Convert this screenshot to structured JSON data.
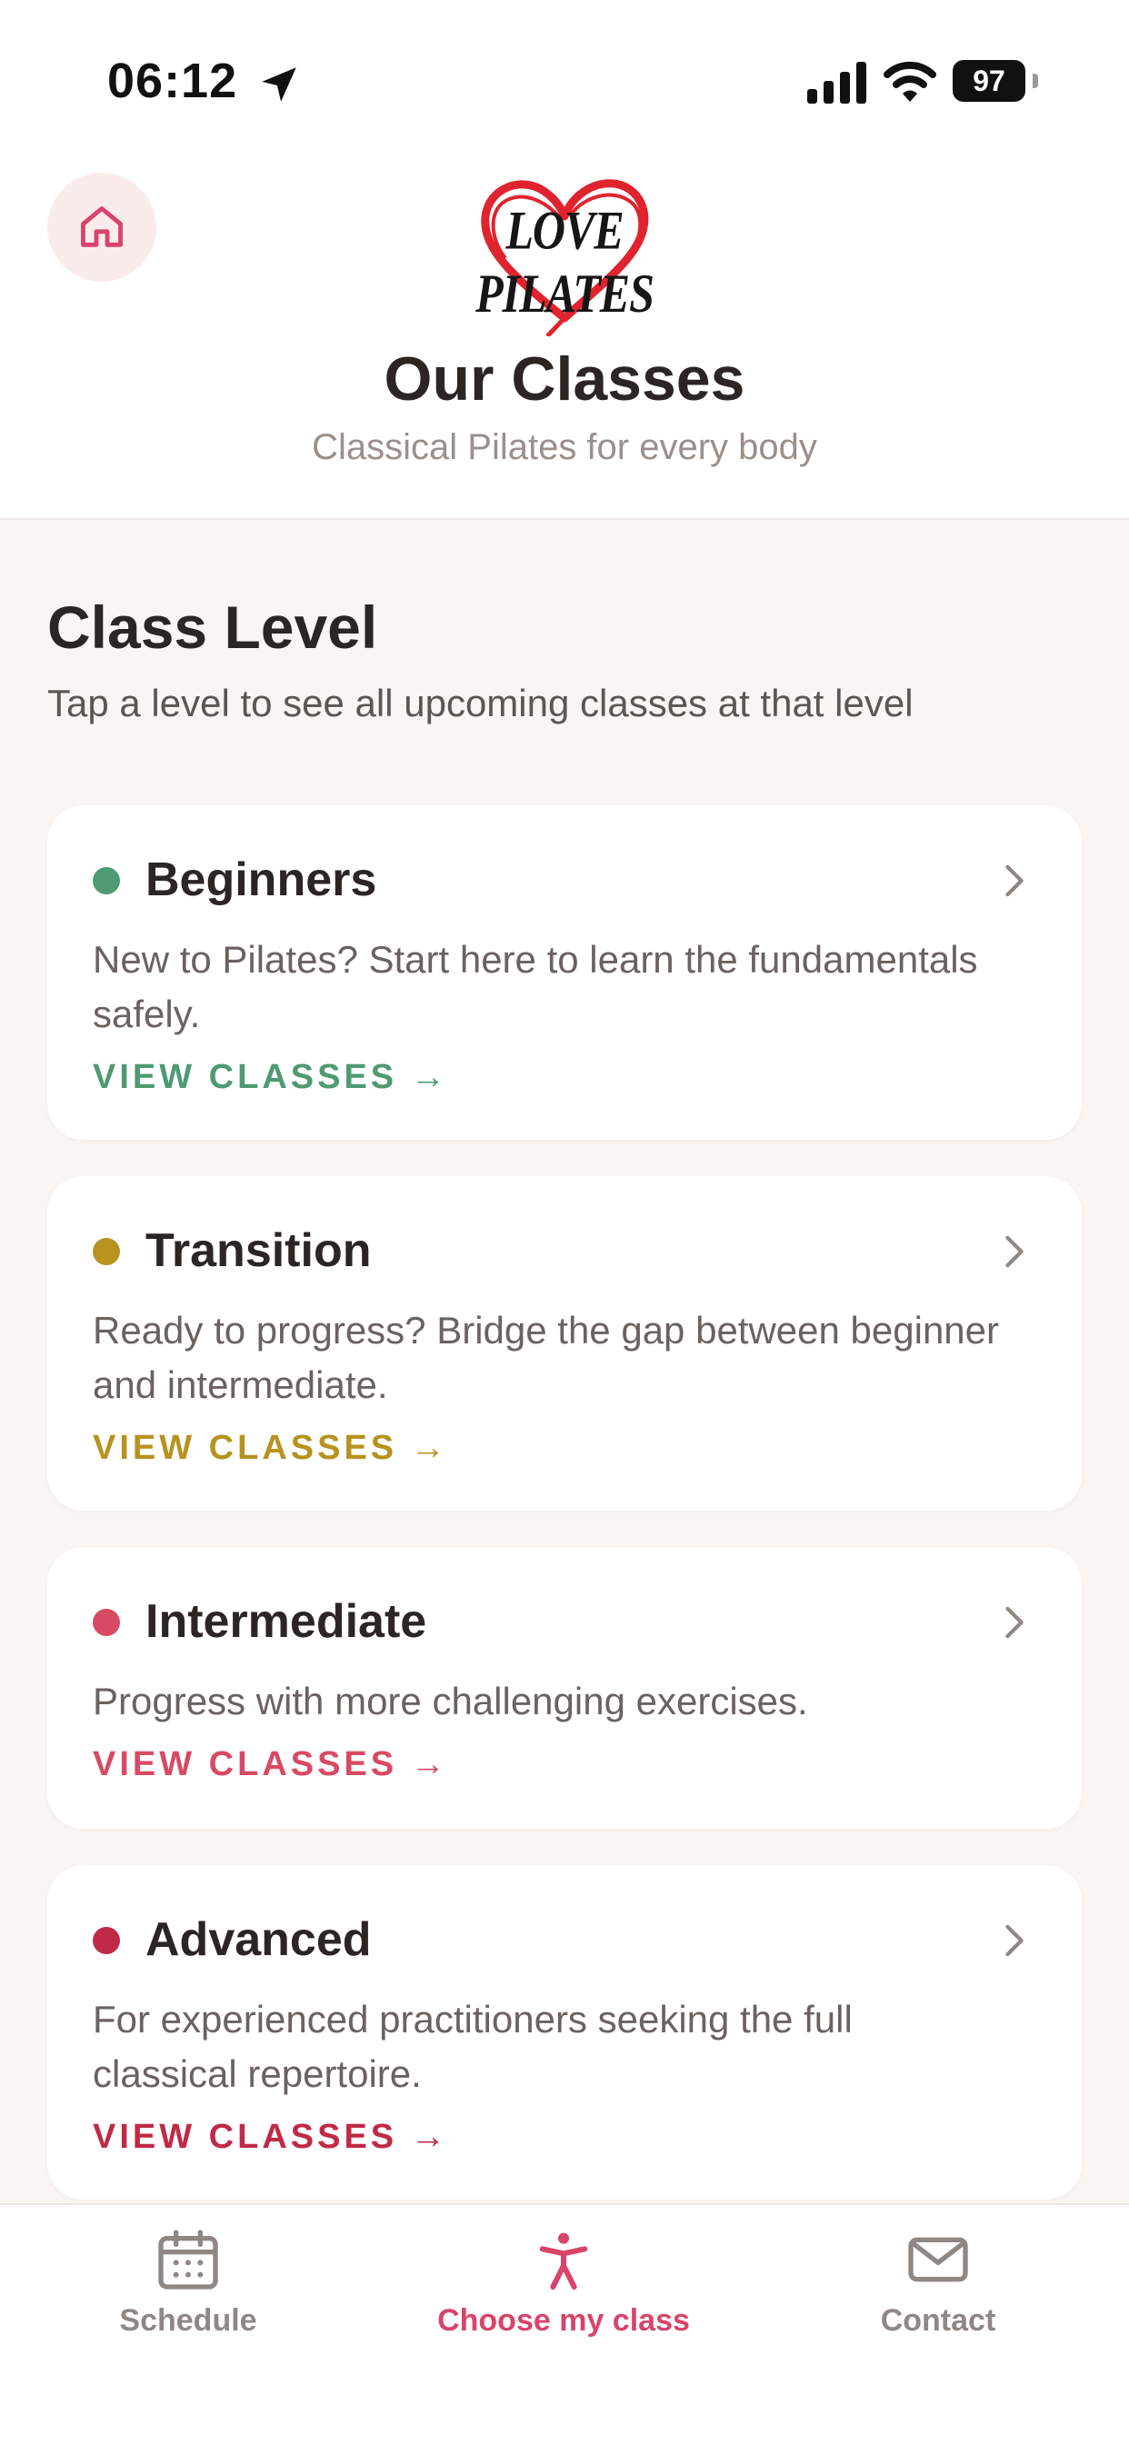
{
  "status_bar": {
    "time": "06:12",
    "battery": "97"
  },
  "header": {
    "logo_text": "LOVE PILATES",
    "title": "Our Classes",
    "subtitle": "Classical Pilates for every body"
  },
  "section": {
    "title": "Class Level",
    "subtitle": "Tap a level to see all upcoming classes at that level"
  },
  "levels": [
    {
      "name": "Beginners",
      "description": "New to Pilates? Start here to learn the fundamentals safely.",
      "link": "VIEW CLASSES →",
      "color": "#4e9a72"
    },
    {
      "name": "Transition",
      "description": "Ready to progress? Bridge the gap between beginner and intermediate.",
      "link": "VIEW CLASSES →",
      "color": "#b8921f"
    },
    {
      "name": "Intermediate",
      "description": "Progress with more challenging exercises.",
      "link": "VIEW CLASSES →",
      "color": "#d84a64"
    },
    {
      "name": "Advanced",
      "description": "For experienced practitioners seeking the full classical repertoire.",
      "link": "VIEW CLASSES →",
      "color": "#c02a47"
    }
  ],
  "tabs": [
    {
      "label": "Schedule",
      "icon": "calendar-icon",
      "active": false
    },
    {
      "label": "Choose my class",
      "icon": "person-icon",
      "active": true
    },
    {
      "label": "Contact",
      "icon": "mail-icon",
      "active": false
    }
  ],
  "colors": {
    "accent": "#d8446a",
    "inactive": "#8f8783",
    "background": "#f8f5f3"
  }
}
